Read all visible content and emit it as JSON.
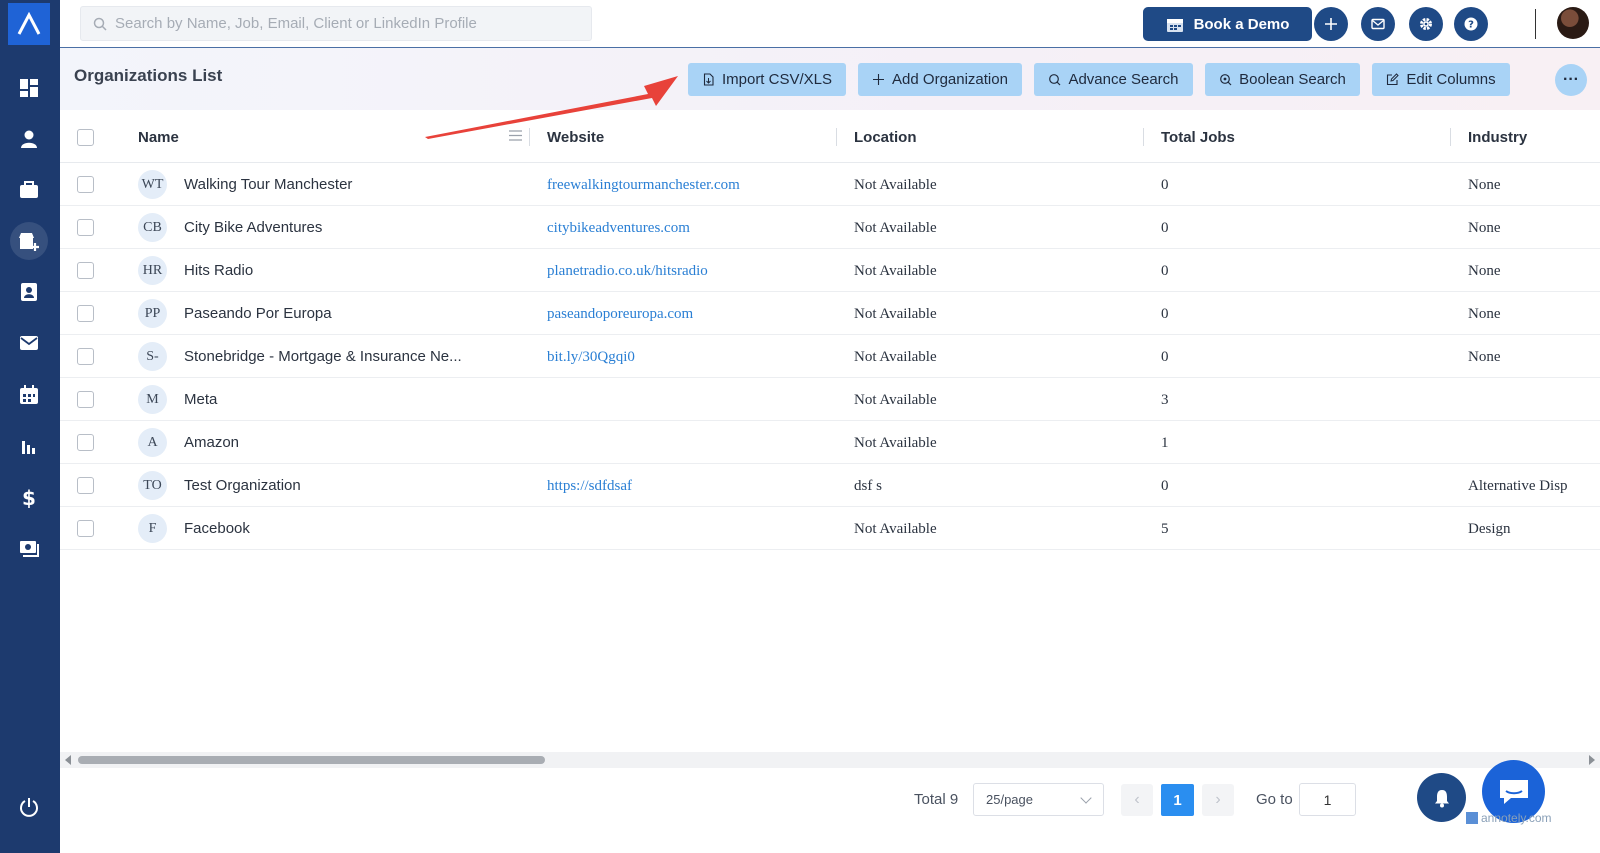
{
  "search": {
    "placeholder": "Search by Name, Job, Email, Client or LinkedIn Profile"
  },
  "topbar": {
    "book_demo": "Book a Demo"
  },
  "sidebar": {
    "items": [
      "dashboard",
      "candidates",
      "jobs",
      "organizations",
      "contacts",
      "mail",
      "calendar",
      "reports",
      "billing",
      "payouts",
      "power"
    ]
  },
  "page": {
    "title": "Organizations List"
  },
  "actions": {
    "import": "Import CSV/XLS",
    "add": "Add Organization",
    "advance": "Advance Search",
    "boolean": "Boolean Search",
    "edit_columns": "Edit Columns",
    "more": "···"
  },
  "table": {
    "columns": [
      "Name",
      "Website",
      "Location",
      "Total Jobs",
      "Industry"
    ],
    "rows": [
      {
        "initials": "WT",
        "name": "Walking Tour Manchester",
        "website": "freewalkingtourmanchester.com",
        "location": "Not Available",
        "jobs": "0",
        "industry": "None"
      },
      {
        "initials": "CB",
        "name": "City Bike Adventures",
        "website": "citybikeadventures.com",
        "location": "Not Available",
        "jobs": "0",
        "industry": "None"
      },
      {
        "initials": "HR",
        "name": "Hits Radio",
        "website": "planetradio.co.uk/hitsradio",
        "location": "Not Available",
        "jobs": "0",
        "industry": "None"
      },
      {
        "initials": "PP",
        "name": "Paseando Por Europa",
        "website": "paseandoporeuropa.com",
        "location": "Not Available",
        "jobs": "0",
        "industry": "None"
      },
      {
        "initials": "S-",
        "name": "Stonebridge - Mortgage & Insurance Ne...",
        "website": "bit.ly/30Qgqi0",
        "location": "Not Available",
        "jobs": "0",
        "industry": "None"
      },
      {
        "initials": "M",
        "name": "Meta",
        "website": "",
        "location": "Not Available",
        "jobs": "3",
        "industry": ""
      },
      {
        "initials": "A",
        "name": "Amazon",
        "website": "",
        "location": "Not Available",
        "jobs": "1",
        "industry": ""
      },
      {
        "initials": "TO",
        "name": "Test Organization",
        "website": "https://sdfdsaf",
        "location": "dsf s",
        "jobs": "0",
        "industry": "Alternative Disp"
      },
      {
        "initials": "F",
        "name": "Facebook",
        "website": "",
        "location": "Not Available",
        "jobs": "5",
        "industry": "Design"
      }
    ]
  },
  "pagination": {
    "total": "Total 9",
    "page_size": "25/page",
    "prev": "‹",
    "current": "1",
    "next": "›",
    "goto_label": "Go to",
    "goto_value": "1"
  },
  "watermark": "annotely.com",
  "colors": {
    "sidebar": "#1d3a6e",
    "primary": "#1f4a86",
    "action_button": "#a9d3f6",
    "link": "#2a7fd4",
    "annotation_arrow": "#e8423a"
  }
}
